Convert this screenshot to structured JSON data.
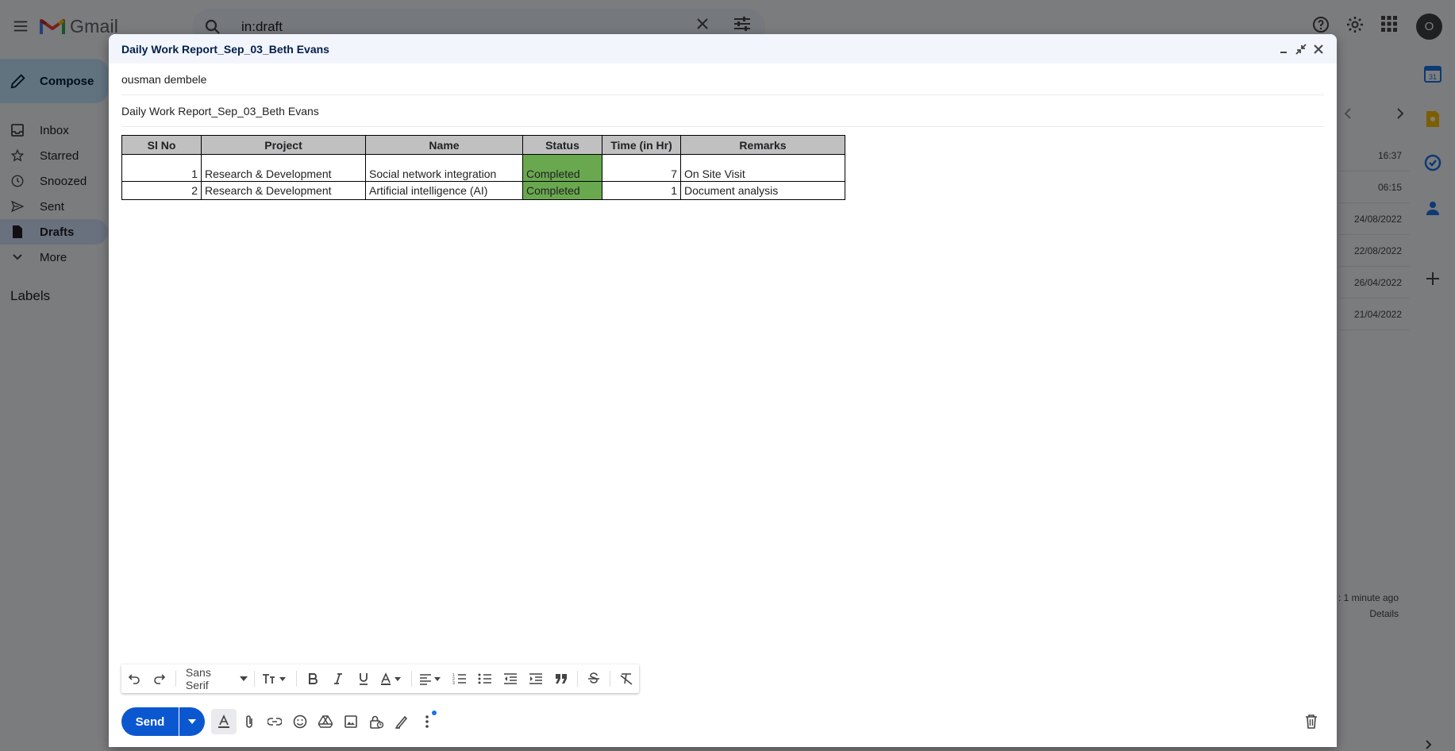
{
  "app": {
    "name": "Gmail"
  },
  "search": {
    "value": "in:draft"
  },
  "account": {
    "initial": "O"
  },
  "nav": {
    "compose_label": "Compose",
    "items": [
      {
        "label": "Inbox",
        "icon": "inbox-icon"
      },
      {
        "label": "Starred",
        "icon": "star-icon"
      },
      {
        "label": "Snoozed",
        "icon": "clock-icon"
      },
      {
        "label": "Sent",
        "icon": "send-icon"
      },
      {
        "label": "Drafts",
        "icon": "draft-icon",
        "active": true
      },
      {
        "label": "More",
        "icon": "chevron-down-icon"
      }
    ],
    "labels_heading": "Labels"
  },
  "maillist": {
    "times": [
      "16:37",
      "06:15",
      "24/08/2022",
      "22/08/2022",
      "26/04/2022",
      "21/04/2022"
    ],
    "last_activity": ": 1 minute ago",
    "details": "Details"
  },
  "compose": {
    "title": "Daily Work Report_Sep_03_Beth Evans",
    "to": "ousman dembele",
    "subject": "Daily Work Report_Sep_03_Beth Evans",
    "table": {
      "headers": [
        "Sl No",
        "Project",
        "Name",
        "Status",
        "Time (in Hr)",
        "Remarks"
      ],
      "rows": [
        [
          "1",
          "Research & Development",
          "Social network integration",
          "Completed",
          "7",
          "On Site Visit"
        ],
        [
          "2",
          "Research & Development",
          "Artificial intelligence (AI)",
          "Completed",
          "1",
          "Document analysis"
        ]
      ],
      "status_color": "#6aa84f",
      "header_color": "#c0c0c0"
    },
    "toolbar": {
      "font": "Sans Serif"
    },
    "send_label": "Send"
  },
  "colors": {
    "send_button": "#0b57d0",
    "compose_button": "#c2e7ff"
  }
}
